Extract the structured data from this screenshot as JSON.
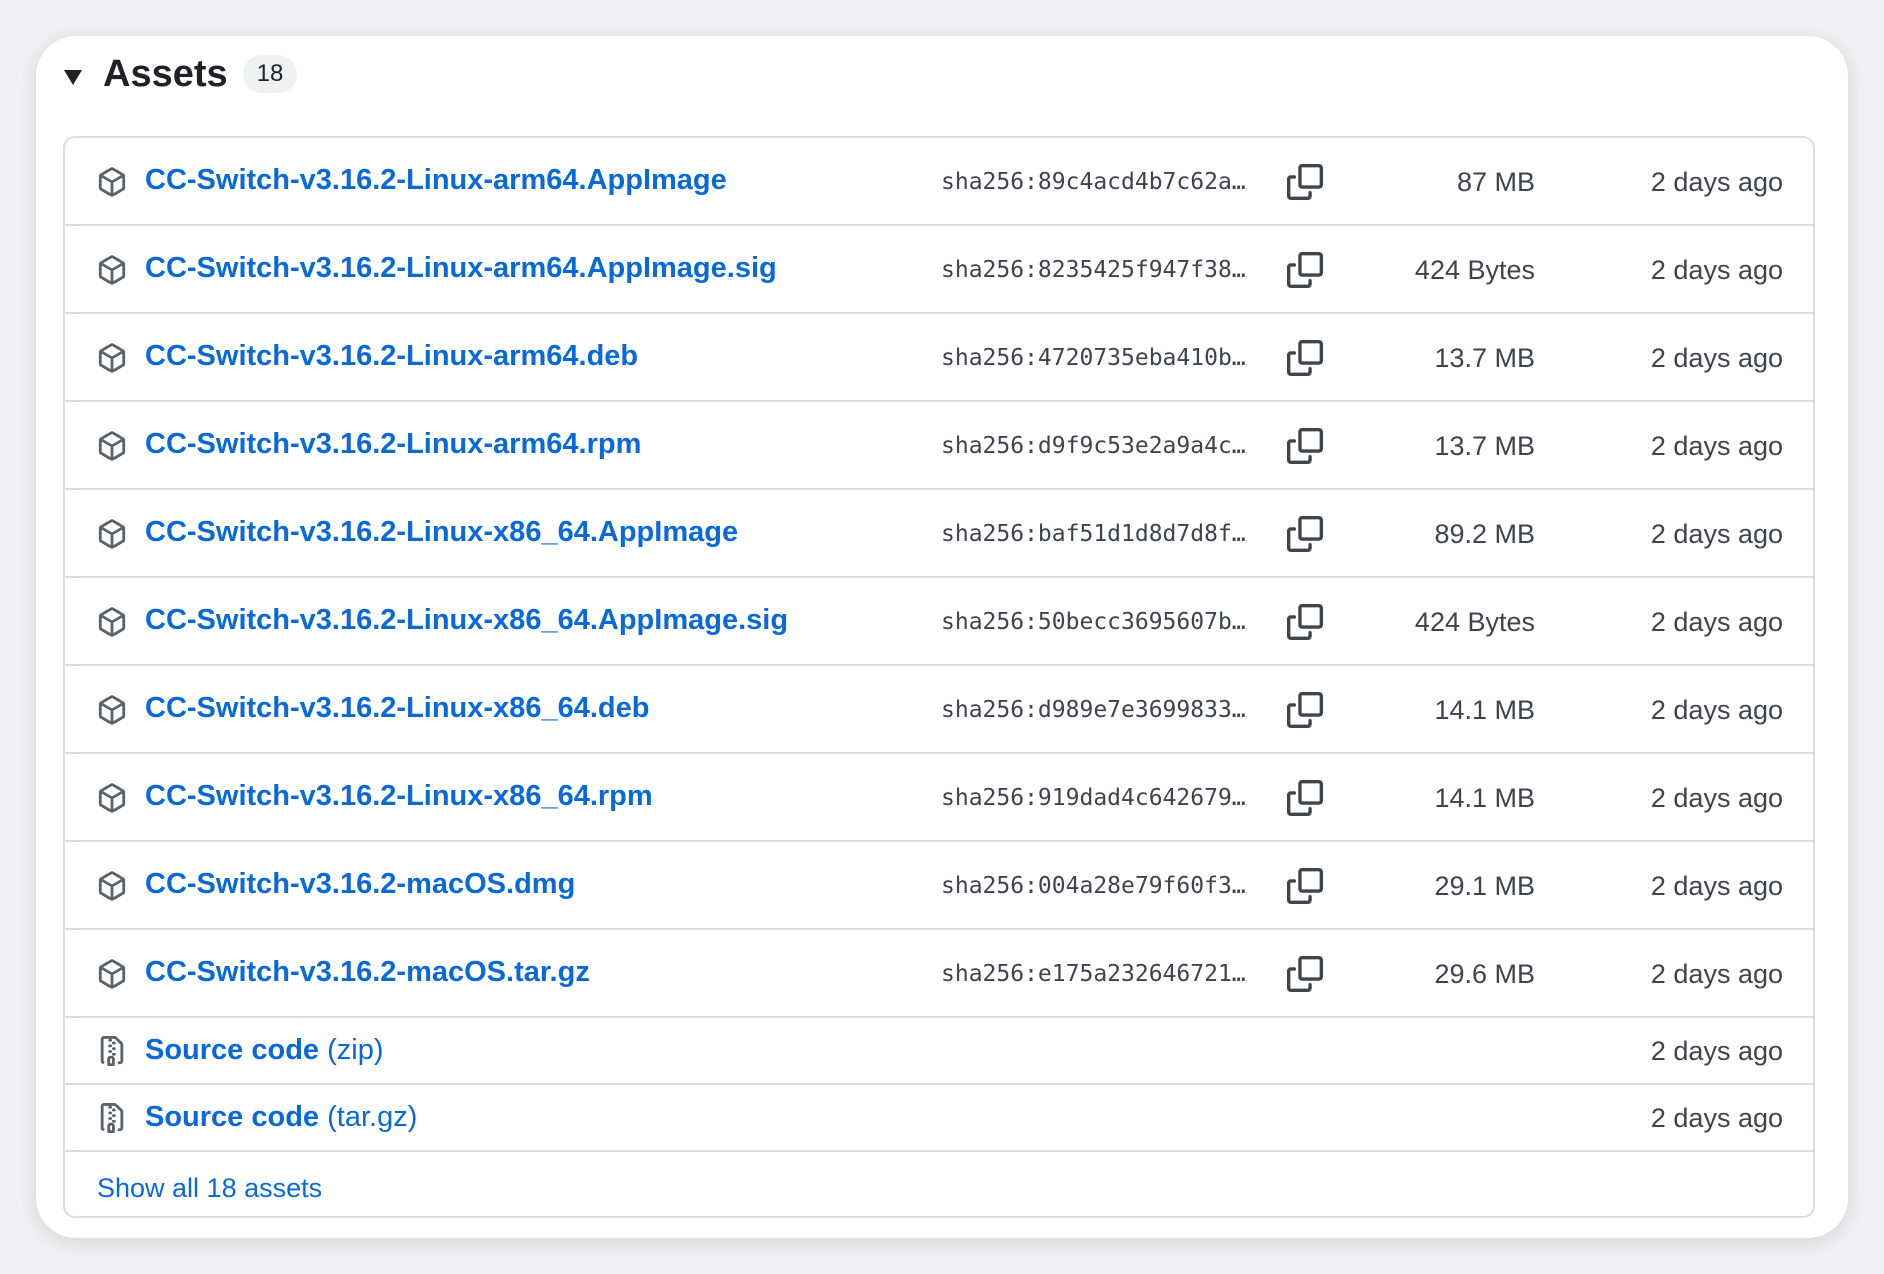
{
  "assets": {
    "title": "Assets",
    "count": "18",
    "rows": [
      {
        "name": "CC-Switch-v3.16.2-Linux-arm64.AppImage",
        "sha": "sha256:89c4acd4b7c62a…",
        "size": "87 MB",
        "date": "2 days ago",
        "icon": "package-icon"
      },
      {
        "name": "CC-Switch-v3.16.2-Linux-arm64.AppImage.sig",
        "sha": "sha256:8235425f947f38…",
        "size": "424 Bytes",
        "date": "2 days ago",
        "icon": "package-icon"
      },
      {
        "name": "CC-Switch-v3.16.2-Linux-arm64.deb",
        "sha": "sha256:4720735eba410b…",
        "size": "13.7 MB",
        "date": "2 days ago",
        "icon": "package-icon"
      },
      {
        "name": "CC-Switch-v3.16.2-Linux-arm64.rpm",
        "sha": "sha256:d9f9c53e2a9a4c…",
        "size": "13.7 MB",
        "date": "2 days ago",
        "icon": "package-icon"
      },
      {
        "name": "CC-Switch-v3.16.2-Linux-x86_64.AppImage",
        "sha": "sha256:baf51d1d8d7d8f…",
        "size": "89.2 MB",
        "date": "2 days ago",
        "icon": "package-icon"
      },
      {
        "name": "CC-Switch-v3.16.2-Linux-x86_64.AppImage.sig",
        "sha": "sha256:50becc3695607b…",
        "size": "424 Bytes",
        "date": "2 days ago",
        "icon": "package-icon"
      },
      {
        "name": "CC-Switch-v3.16.2-Linux-x86_64.deb",
        "sha": "sha256:d989e7e3699833…",
        "size": "14.1 MB",
        "date": "2 days ago",
        "icon": "package-icon"
      },
      {
        "name": "CC-Switch-v3.16.2-Linux-x86_64.rpm",
        "sha": "sha256:919dad4c642679…",
        "size": "14.1 MB",
        "date": "2 days ago",
        "icon": "package-icon"
      },
      {
        "name": "CC-Switch-v3.16.2-macOS.dmg",
        "sha": "sha256:004a28e79f60f3…",
        "size": "29.1 MB",
        "date": "2 days ago",
        "icon": "package-icon"
      },
      {
        "name": "CC-Switch-v3.16.2-macOS.tar.gz",
        "sha": "sha256:e175a232646721…",
        "size": "29.6 MB",
        "date": "2 days ago",
        "icon": "package-icon"
      }
    ],
    "source_rows": [
      {
        "name": "Source code",
        "suffix": "(zip)",
        "date": "2 days ago",
        "icon": "file-zip-icon"
      },
      {
        "name": "Source code",
        "suffix": "(tar.gz)",
        "date": "2 days ago",
        "icon": "file-zip-icon"
      }
    ],
    "show_all_label": "Show all 18 assets"
  },
  "colors": {
    "link": "#0969da",
    "muted_text": "#3d444d",
    "border": "#d8dee4",
    "counter_bg": "#eef0f2"
  }
}
